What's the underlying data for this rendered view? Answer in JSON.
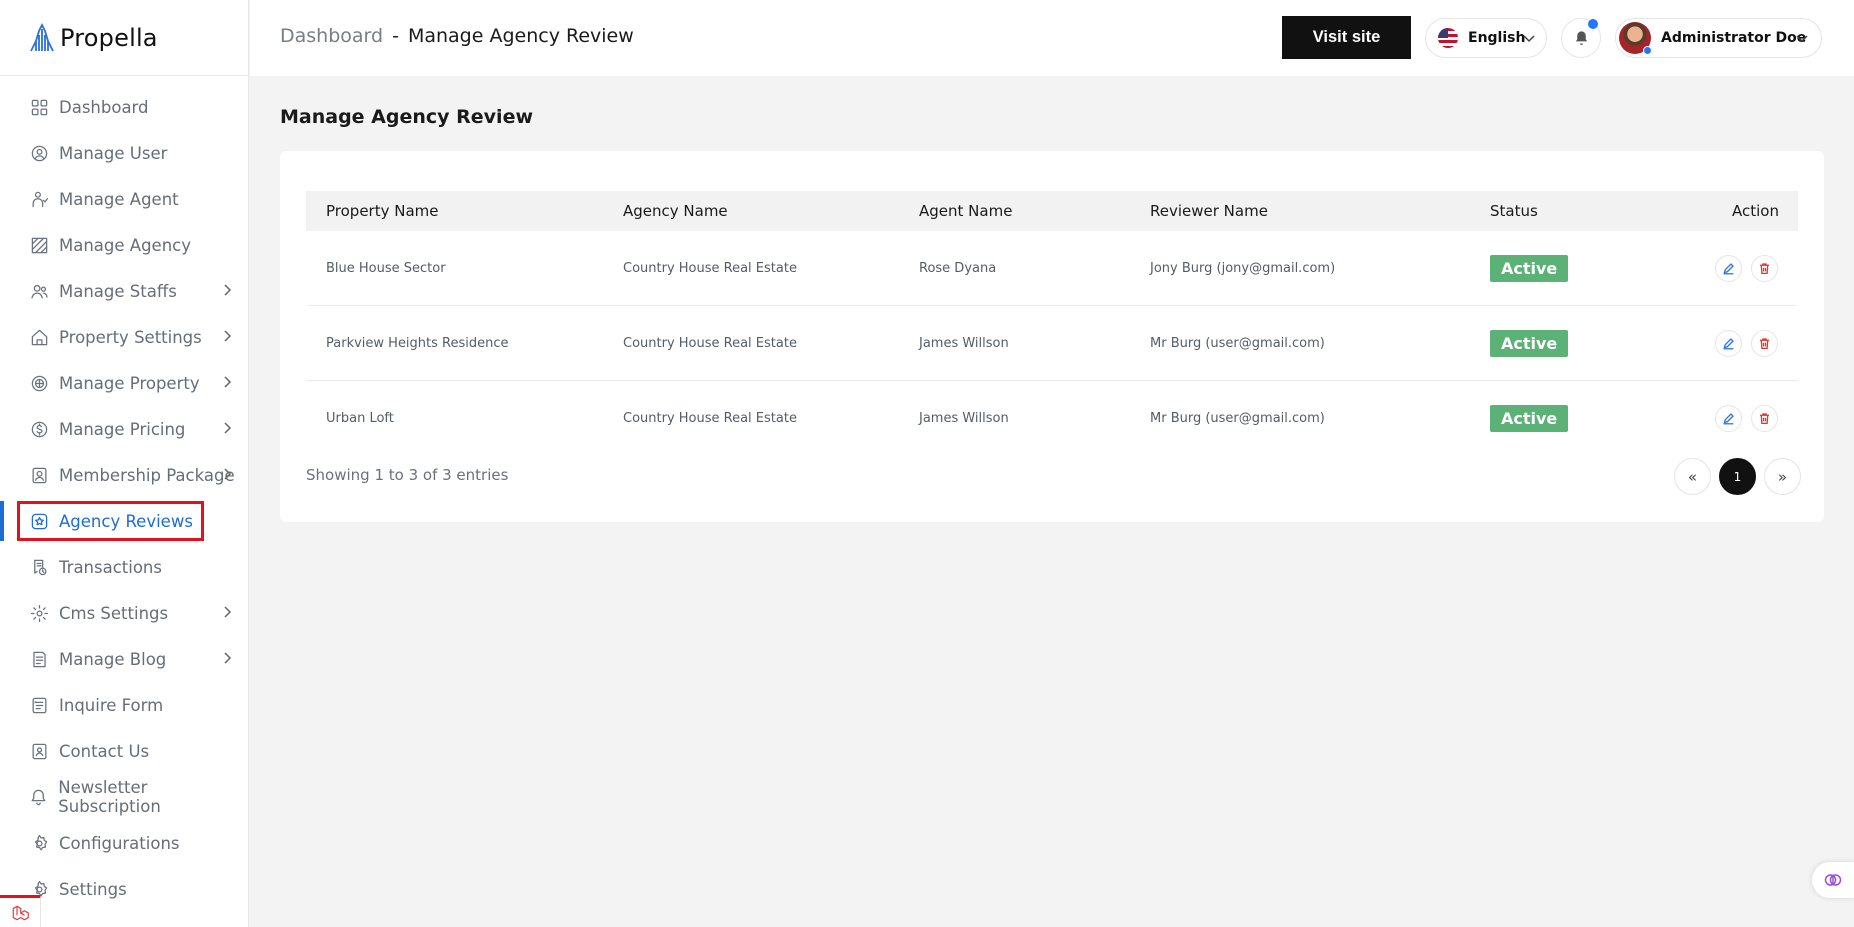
{
  "brand": {
    "name": "Propella"
  },
  "sidebar": {
    "items": [
      {
        "label": "Dashboard",
        "icon": "dashboard-icon",
        "has_children": false,
        "active": false
      },
      {
        "label": "Manage User",
        "icon": "user-icon",
        "has_children": false,
        "active": false
      },
      {
        "label": "Manage Agent",
        "icon": "agent-icon",
        "has_children": false,
        "active": false
      },
      {
        "label": "Manage Agency",
        "icon": "agency-icon",
        "has_children": false,
        "active": false
      },
      {
        "label": "Manage Staffs",
        "icon": "staff-icon",
        "has_children": true,
        "active": false
      },
      {
        "label": "Property Settings",
        "icon": "house-icon",
        "has_children": true,
        "active": false
      },
      {
        "label": "Manage Property",
        "icon": "property-icon",
        "has_children": true,
        "active": false
      },
      {
        "label": "Manage Pricing",
        "icon": "pricing-icon",
        "has_children": true,
        "active": false
      },
      {
        "label": "Membership Package",
        "icon": "membership-icon",
        "has_children": true,
        "active": false
      },
      {
        "label": "Agency Reviews",
        "icon": "review-icon",
        "has_children": false,
        "active": true
      },
      {
        "label": "Transactions",
        "icon": "transactions-icon",
        "has_children": false,
        "active": false
      },
      {
        "label": "Cms Settings",
        "icon": "cms-icon",
        "has_children": true,
        "active": false
      },
      {
        "label": "Manage Blog",
        "icon": "blog-icon",
        "has_children": true,
        "active": false
      },
      {
        "label": "Inquire Form",
        "icon": "form-icon",
        "has_children": false,
        "active": false
      },
      {
        "label": "Contact Us",
        "icon": "contact-icon",
        "has_children": false,
        "active": false
      },
      {
        "label": "Newsletter Subscription",
        "icon": "bell-icon",
        "has_children": false,
        "active": false
      },
      {
        "label": "Configurations",
        "icon": "config-icon",
        "has_children": false,
        "active": false
      },
      {
        "label": "Settings",
        "icon": "settings-icon",
        "has_children": false,
        "active": false
      }
    ]
  },
  "header": {
    "breadcrumb_root": "Dashboard",
    "breadcrumb_sep": "-",
    "breadcrumb_current": "Manage Agency Review",
    "visit_site": "Visit site",
    "language": "English",
    "user_name": "Administrator Doe"
  },
  "main": {
    "title": "Manage Agency Review",
    "columns": [
      "Property Name",
      "Agency Name",
      "Agent Name",
      "Reviewer Name",
      "Status",
      "Action"
    ],
    "rows": [
      {
        "property": "Blue House Sector",
        "agency": "Country House Real Estate",
        "agent": "Rose Dyana",
        "reviewer": "Jony Burg (jony@gmail.com)",
        "status": "Active"
      },
      {
        "property": "Parkview Heights Residence",
        "agency": "Country House Real Estate",
        "agent": "James Willson",
        "reviewer": "Mr Burg (user@gmail.com)",
        "status": "Active"
      },
      {
        "property": "Urban Loft",
        "agency": "Country House Real Estate",
        "agent": "James Willson",
        "reviewer": "Mr Burg (user@gmail.com)",
        "status": "Active"
      }
    ],
    "info": "Showing 1 to 3 of 3 entries",
    "pager": {
      "prev": "«",
      "current": "1",
      "next": "»"
    }
  },
  "colors": {
    "accent": "#1e6cd6",
    "status_active": "#5cb176",
    "highlight_border": "#e3101d"
  }
}
